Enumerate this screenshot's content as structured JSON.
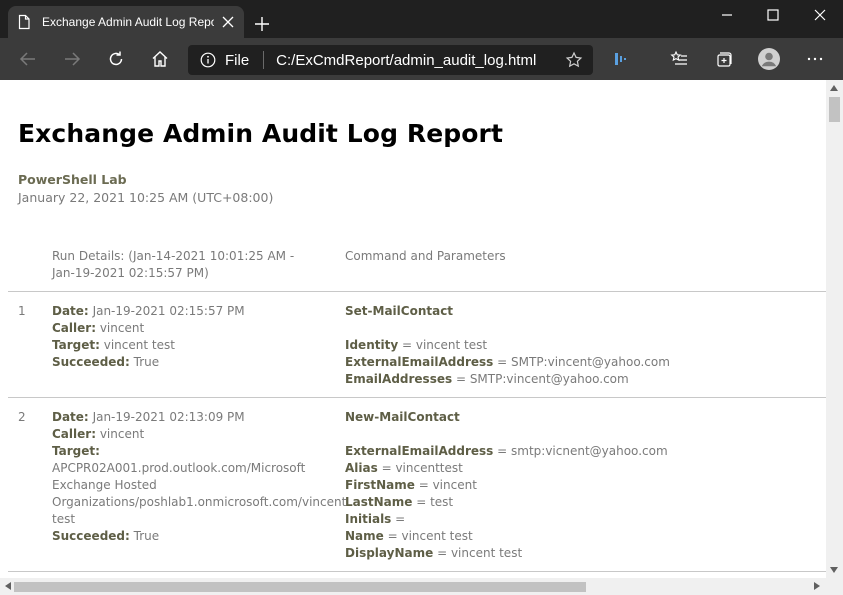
{
  "browser": {
    "tab_title": "Exchange Admin Audit Log Report",
    "address_scheme_label": "File",
    "url": "C:/ExCmdReport/admin_audit_log.html"
  },
  "report": {
    "title": "Exchange Admin Audit Log Report",
    "organization": "PowerShell Lab",
    "generated": "January 22, 2021 10:25 AM (UTC+08:00)",
    "column_details": "Run Details: (Jan-14-2021 10:01:25 AM - Jan-19-2021 02:15:57 PM)",
    "column_command": "Command and Parameters",
    "labels": {
      "date": "Date:",
      "caller": "Caller:",
      "target": "Target:",
      "succeeded": "Succeeded:"
    },
    "entries": [
      {
        "number": "1",
        "date": "Jan-19-2021 02:15:57 PM",
        "caller": "vincent",
        "target": "vincent test",
        "succeeded": "True",
        "command": "Set-MailContact",
        "parameters": [
          {
            "name": "Identity",
            "value": "vincent test"
          },
          {
            "name": "ExternalEmailAddress",
            "value": "SMTP:vincent@yahoo.com"
          },
          {
            "name": "EmailAddresses",
            "value": "SMTP:vincent@yahoo.com"
          }
        ]
      },
      {
        "number": "2",
        "date": "Jan-19-2021 02:13:09 PM",
        "caller": "vincent",
        "target_lines": [
          "APCPR02A001.prod.outlook.com/Microsoft",
          "Exchange Hosted",
          "Organizations/poshlab1.onmicrosoft.com/vincent",
          "test"
        ],
        "succeeded": "True",
        "command": "New-MailContact",
        "parameters": [
          {
            "name": "ExternalEmailAddress",
            "value": "smtp:vicnent@yahoo.com"
          },
          {
            "name": "Alias",
            "value": "vincenttest"
          },
          {
            "name": "FirstName",
            "value": "vincent"
          },
          {
            "name": "LastName",
            "value": "test"
          },
          {
            "name": "Initials",
            "value": ""
          },
          {
            "name": "Name",
            "value": "vincent test"
          },
          {
            "name": "DisplayName",
            "value": "vincent test"
          }
        ]
      }
    ],
    "param_separator": " = "
  },
  "icons": {
    "tab": "page-icon",
    "close_tab": "close-icon",
    "new_tab": "plus-icon",
    "back": "back-arrow-icon",
    "forward": "forward-arrow-icon",
    "refresh": "refresh-icon",
    "home": "home-icon",
    "info": "info-icon",
    "favorite": "star-icon",
    "extension": "extension-icon",
    "favorites": "favorites-list-icon",
    "collections": "collections-icon",
    "profile": "profile-avatar-icon",
    "menu": "more-icon"
  },
  "colors": {
    "titlebar": "#202020",
    "toolbar": "#3b3b3b",
    "bold_label": "#5e5e46",
    "muted_text": "#7a7a7a"
  }
}
